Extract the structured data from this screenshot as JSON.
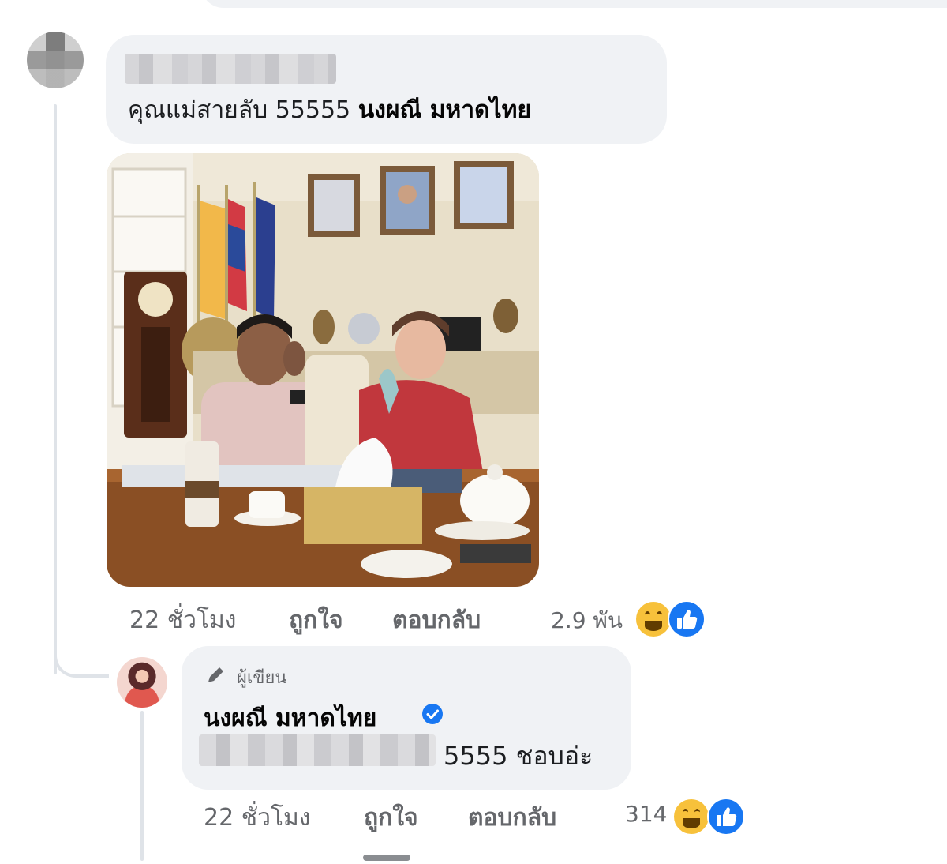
{
  "comment": {
    "text_plain": "คุณแม่สายลับ 55555",
    "text_tag": "นงผณี มหาดไทย",
    "meta": {
      "time": "22 ชั่วโมง",
      "like_label": "ถูกใจ",
      "reply_label": "ตอบกลับ",
      "reaction_count": "2.9 พัน"
    }
  },
  "reply": {
    "author_badge": "ผู้เขียน",
    "author_name": "นงผณี มหาดไทย",
    "text_visible": "5555 ชอบอ่ะ",
    "meta": {
      "time": "22 ชั่วโมง",
      "like_label": "ถูกใจ",
      "reply_label": "ตอบกลับ",
      "reaction_count": "314"
    }
  },
  "reaction_icons": [
    "haha-icon",
    "like-icon"
  ],
  "colors": {
    "bubble": "#f0f2f5",
    "meta_text": "#65676b",
    "verified": "#1877f2",
    "haha": "#f7c13b",
    "like": "#1877f2"
  }
}
